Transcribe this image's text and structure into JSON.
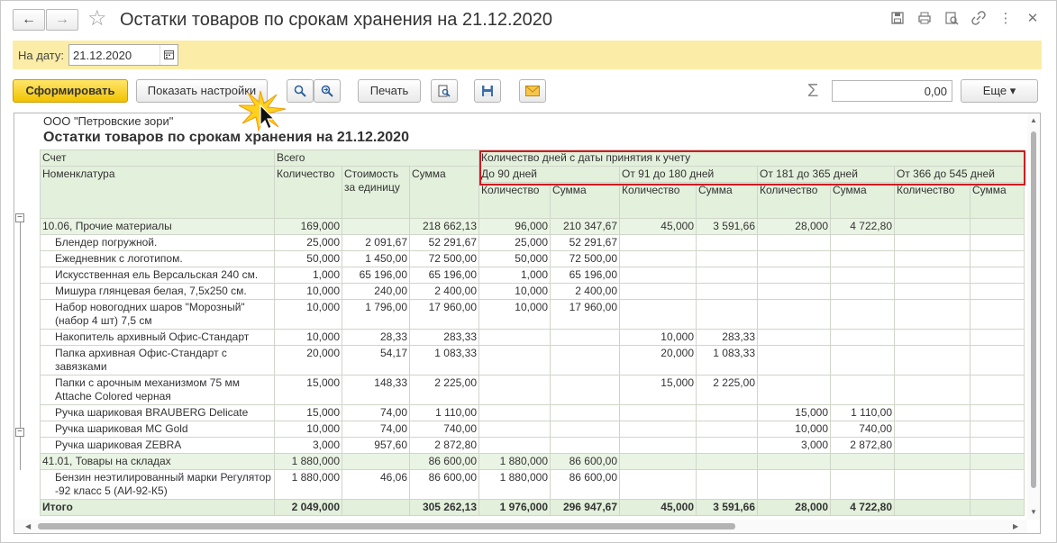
{
  "window": {
    "title": "Остатки товаров по срокам хранения на 21.12.2020"
  },
  "datebar": {
    "label": "На дату:",
    "date_value": "21.12.2020"
  },
  "toolbar": {
    "generate_label": "Сформировать",
    "settings_label": "Показать настройки",
    "print_label": "Печать",
    "sum_value": "0,00",
    "more_label": "Еще ▾"
  },
  "report": {
    "org": "ООО \"Петровские зори\"",
    "title": "Остатки товаров по срокам хранения на 21.12.2020",
    "headers": {
      "account": "Счет",
      "total": "Всего",
      "days_group": "Количество дней с даты принятия к учету",
      "nomenclature": "Номенклатура",
      "qty": "Количество",
      "cost": "Стоимость за единицу",
      "sum": "Сумма",
      "periods": [
        "До 90 дней",
        "От 91 до 180 дней",
        "От 181 до 365 дней",
        "От 366 до 545 дней"
      ],
      "sub": [
        "Количество",
        "Сумма",
        "Количество",
        "Сумма",
        "Количество",
        "Сумма",
        "Количество",
        "Сумма"
      ]
    },
    "rows": [
      {
        "type": "group",
        "name": "10.06, Прочие материалы",
        "v": [
          "169,000",
          "",
          "218 662,13",
          "96,000",
          "210 347,67",
          "45,000",
          "3 591,66",
          "28,000",
          "4 722,80",
          "",
          ""
        ]
      },
      {
        "type": "item",
        "name": "Блендер погружной.",
        "v": [
          "25,000",
          "2 091,67",
          "52 291,67",
          "25,000",
          "52 291,67",
          "",
          "",
          "",
          "",
          "",
          ""
        ]
      },
      {
        "type": "item",
        "name": "Ежедневник с логотипом.",
        "v": [
          "50,000",
          "1 450,00",
          "72 500,00",
          "50,000",
          "72 500,00",
          "",
          "",
          "",
          "",
          "",
          ""
        ]
      },
      {
        "type": "item",
        "name": "Искусственная ель Версальская 240 см.",
        "v": [
          "1,000",
          "65 196,00",
          "65 196,00",
          "1,000",
          "65 196,00",
          "",
          "",
          "",
          "",
          "",
          ""
        ]
      },
      {
        "type": "item",
        "name": "Мишура глянцевая белая, 7,5х250 см.",
        "v": [
          "10,000",
          "240,00",
          "2 400,00",
          "10,000",
          "2 400,00",
          "",
          "",
          "",
          "",
          "",
          ""
        ]
      },
      {
        "type": "item",
        "name": "Набор новогодних шаров \"Морозный\" (набор 4 шт) 7,5 см",
        "v": [
          "10,000",
          "1 796,00",
          "17 960,00",
          "10,000",
          "17 960,00",
          "",
          "",
          "",
          "",
          "",
          ""
        ]
      },
      {
        "type": "item",
        "name": "Накопитель архивный Офис-Стандарт",
        "v": [
          "10,000",
          "28,33",
          "283,33",
          "",
          "",
          "10,000",
          "283,33",
          "",
          "",
          "",
          ""
        ]
      },
      {
        "type": "item",
        "name": "Папка архивная Офис-Стандарт с завязками",
        "v": [
          "20,000",
          "54,17",
          "1 083,33",
          "",
          "",
          "20,000",
          "1 083,33",
          "",
          "",
          "",
          ""
        ]
      },
      {
        "type": "item",
        "name": "Папки с арочным механизмом 75 мм Attache Colored черная",
        "v": [
          "15,000",
          "148,33",
          "2 225,00",
          "",
          "",
          "15,000",
          "2 225,00",
          "",
          "",
          "",
          ""
        ]
      },
      {
        "type": "item",
        "name": "Ручка шариковая BRAUBERG Delicate",
        "v": [
          "15,000",
          "74,00",
          "1 110,00",
          "",
          "",
          "",
          "",
          "15,000",
          "1 110,00",
          "",
          ""
        ]
      },
      {
        "type": "item",
        "name": "Ручка шариковая MC Gold",
        "v": [
          "10,000",
          "74,00",
          "740,00",
          "",
          "",
          "",
          "",
          "10,000",
          "740,00",
          "",
          ""
        ]
      },
      {
        "type": "item",
        "name": "Ручка шариковая ZEBRA",
        "v": [
          "3,000",
          "957,60",
          "2 872,80",
          "",
          "",
          "",
          "",
          "3,000",
          "2 872,80",
          "",
          ""
        ]
      },
      {
        "type": "group",
        "name": "41.01, Товары на складах",
        "v": [
          "1 880,000",
          "",
          "86 600,00",
          "1 880,000",
          "86 600,00",
          "",
          "",
          "",
          "",
          "",
          ""
        ]
      },
      {
        "type": "item",
        "name": "Бензин неэтилированный марки Регулятор -92 класс 5 (АИ-92-К5)",
        "v": [
          "1 880,000",
          "46,06",
          "86 600,00",
          "1 880,000",
          "86 600,00",
          "",
          "",
          "",
          "",
          "",
          ""
        ]
      },
      {
        "type": "total",
        "name": "Итого",
        "v": [
          "2 049,000",
          "",
          "305 262,13",
          "1 976,000",
          "296 947,67",
          "45,000",
          "3 591,66",
          "28,000",
          "4 722,80",
          "",
          ""
        ]
      }
    ]
  }
}
